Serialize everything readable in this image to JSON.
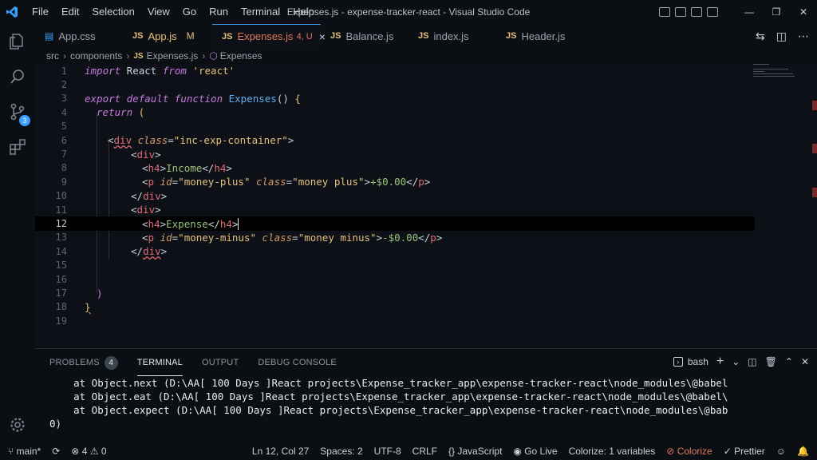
{
  "window": {
    "title": "Expenses.js - expense-tracker-react - Visual Studio Code"
  },
  "menu": [
    "File",
    "Edit",
    "Selection",
    "View",
    "Go",
    "Run",
    "Terminal",
    "Help"
  ],
  "activity": {
    "source_control_badge": "3"
  },
  "tabs": [
    {
      "lang": "CSS",
      "name": "App.css"
    },
    {
      "lang": "JS",
      "name": "App.js",
      "mod": "M"
    },
    {
      "lang": "JS",
      "name": "Expenses.js",
      "state": "4, U",
      "close": "×"
    },
    {
      "lang": "JS",
      "name": "Balance.js"
    },
    {
      "lang": "JS",
      "name": "index.js"
    },
    {
      "lang": "JS",
      "name": "Header.js"
    }
  ],
  "breadcrumb": {
    "p1": "src",
    "p2": "components",
    "lang": "JS",
    "file": "Expenses.js",
    "symbol": "Expenses"
  },
  "editor": {
    "line_numbers": [
      "1",
      "2",
      "3",
      "4",
      "5",
      "6",
      "7",
      "8",
      "9",
      "10",
      "11",
      "12",
      "13",
      "14",
      "15",
      "16",
      "17",
      "18",
      "19"
    ],
    "l1": {
      "kw": "import",
      "id": " React ",
      "kw2": "from",
      "str": " 'react'"
    },
    "l3": {
      "kw": "export default function",
      "fn": " Expenses",
      "punc": "() ",
      "brace": "{"
    },
    "l4": {
      "kw": "return",
      "brace": " ("
    },
    "l6": {
      "open": "<",
      "tag": "div",
      "attr": " class",
      "eq": "=",
      "str": "\"inc-exp-container\"",
      "close": ">"
    },
    "l7": {
      "open": "<",
      "tag": "div",
      "close": ">"
    },
    "l8": {
      "open": "<",
      "tag": "h4",
      "close": ">",
      "txt": "Income",
      "end_open": "</",
      "end_tag": "h4",
      "end_close": ">"
    },
    "l9": {
      "open": "<",
      "tag": "p",
      "a1": " id",
      "eq1": "=",
      "s1": "\"money-plus\"",
      "a2": " class",
      "eq2": "=",
      "s2": "\"money plus\"",
      "close": ">",
      "txt": "+$0.00",
      "end_open": "</",
      "end_tag": "p",
      "end_close": ">"
    },
    "l10": {
      "open": "</",
      "tag": "div",
      "close": ">"
    },
    "l11": {
      "open": "<",
      "tag": "div",
      "close": ">"
    },
    "l12": {
      "open": "<",
      "tag": "h4",
      "close": ">",
      "txt": "Expense",
      "end_open": "</",
      "end_tag": "h4",
      "end_close": ">"
    },
    "l13": {
      "open": "<",
      "tag": "p",
      "a1": " id",
      "eq1": "=",
      "s1": "\"money-minus\"",
      "a2": " class",
      "eq2": "=",
      "s2": "\"money minus\"",
      "close": ">",
      "txt": "-$0.00",
      "end_open": "</",
      "end_tag": "p",
      "end_close": ">"
    },
    "l14": {
      "open": "</",
      "tag": "div",
      "close": ">"
    },
    "l17": {
      "brace": ")"
    },
    "l18": {
      "brace": "}"
    }
  },
  "panel": {
    "tabs": [
      "PROBLEMS",
      "TERMINAL",
      "OUTPUT",
      "DEBUG CONSOLE"
    ],
    "problems_count": "4",
    "shell": "bash",
    "lines": [
      "    at Object.next (D:\\AA[ 100 Days ]React projects\\Expense_tracker_app\\expense-tracker-react\\node_modules\\@babel",
      "    at Object.eat (D:\\AA[ 100 Days ]React projects\\Expense_tracker_app\\expense-tracker-react\\node_modules\\@babel\\",
      "    at Object.expect (D:\\AA[ 100 Days ]React projects\\Expense_tracker_app\\expense-tracker-react\\node_modules\\@bab",
      "0)"
    ]
  },
  "status": {
    "branch": "main*",
    "errors": "4",
    "warnings": "0",
    "position": "Ln 12, Col 27",
    "spaces": "Spaces: 2",
    "encoding": "UTF-8",
    "eol": "CRLF",
    "language": "JavaScript",
    "golive": "Go Live",
    "colorize_vars": "Colorize: 1 variables",
    "colorize": "Colorize",
    "prettier": "Prettier"
  },
  "colors": {
    "accent": "#3aa0ff",
    "background": "#0d1117",
    "tag": "#e06c75",
    "string": "#e5c07b",
    "keyword": "#c678dd"
  }
}
